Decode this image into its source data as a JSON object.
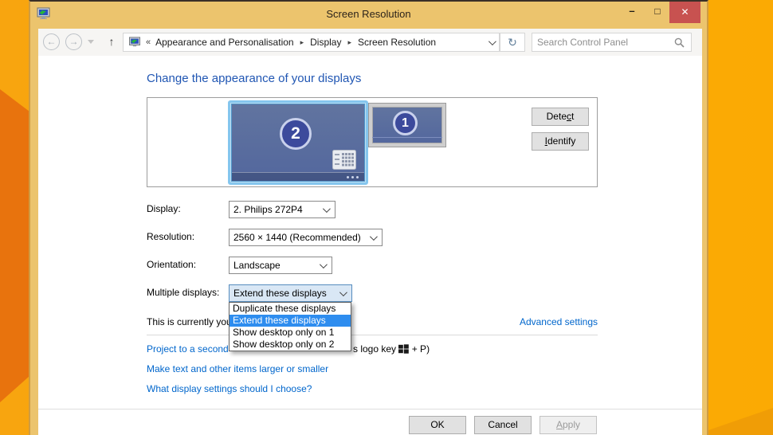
{
  "window": {
    "title": "Screen Resolution"
  },
  "titlebar_icons": {
    "minimize": "–",
    "maximize": "□",
    "close": "✕"
  },
  "navbar": {
    "back_icon": "←",
    "forward_icon": "→",
    "up_icon": "↑",
    "refresh_icon": "↻",
    "breadcrumb": {
      "collapse_prefix": "«",
      "separator": "▸",
      "items": [
        "Appearance and Personalisation",
        "Display",
        "Screen Resolution"
      ]
    },
    "search_placeholder": "Search Control Panel"
  },
  "main": {
    "heading": "Change the appearance of your displays",
    "display_preview": {
      "monitor_large_number": "2",
      "monitor_small_number": "1"
    },
    "detect_button": {
      "pre": "Dete",
      "mnemonic": "c",
      "post": "t"
    },
    "identify_button": {
      "pre": "",
      "mnemonic": "I",
      "post": "dentify"
    },
    "fields": {
      "display": {
        "label": "Display:",
        "value": "2. Philips 272P4"
      },
      "resolution": {
        "label": "Resolution:",
        "value": "2560 × 1440 (Recommended)"
      },
      "orientation": {
        "label": "Orientation:",
        "value": "Landscape"
      },
      "multiple_displays": {
        "label": "Multiple displays:",
        "value": "Extend these displays"
      }
    },
    "multiple_displays_dropdown": {
      "options": [
        "Duplicate these displays",
        "Extend these displays",
        "Show desktop only on 1",
        "Show desktop only on 2"
      ],
      "selected": "Extend these displays",
      "highlight_color": "#2e8def"
    },
    "current_display_text": "This is currently you",
    "advanced_settings_link": "Advanced settings",
    "project_link_text": "Project to a second",
    "project_text_after": "s logo key",
    "project_text_end": "+ P)",
    "make_text_link": "Make text and other items larger or smaller",
    "what_settings_link": "What display settings should I choose?"
  },
  "footer": {
    "ok": "OK",
    "cancel": "Cancel",
    "apply": {
      "pre": "",
      "mnemonic": "A",
      "post": "pply"
    }
  },
  "colors": {
    "desktop": "#f9a60d",
    "desktop_dark": "#e8730d",
    "titlebar": "#ecc46d",
    "close_red": "#c85250",
    "heading_blue": "#2056b3",
    "link_blue": "#0066cc",
    "selection_border": "#85c6ee",
    "monitor_screen": "#5b6fa6",
    "dropdown_highlight": "#2e8def"
  }
}
